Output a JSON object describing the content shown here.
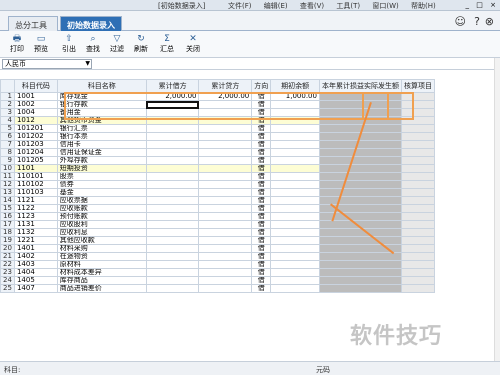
{
  "window": {
    "title": "[初始数据录入]",
    "menus": [
      "文件(F)",
      "编辑(E)",
      "查看(V)",
      "工具(T)",
      "窗口(W)",
      "帮助(H)"
    ],
    "controls": [
      "_",
      "□",
      "×"
    ]
  },
  "tabs": [
    {
      "label": "总分工具",
      "active": false
    },
    {
      "label": "初始数据录入",
      "active": true,
      "close": "×"
    }
  ],
  "toolbar": [
    {
      "label": "打印",
      "icon": "printer-icon",
      "glyph": "🖶"
    },
    {
      "label": "预览",
      "icon": "preview-icon",
      "glyph": "▭"
    },
    {
      "label": "引出",
      "icon": "export-icon",
      "glyph": "⇧"
    },
    {
      "label": "查找",
      "icon": "find-icon",
      "glyph": "⌕"
    },
    {
      "label": "过滤",
      "icon": "filter-icon",
      "glyph": "▽"
    },
    {
      "label": "刷新",
      "icon": "refresh-icon",
      "glyph": "↻"
    },
    {
      "label": "汇总",
      "icon": "summary-icon",
      "glyph": "Σ"
    },
    {
      "label": "关闭",
      "icon": "close-icon",
      "glyph": "✕"
    }
  ],
  "filter": {
    "currency": "人民币"
  },
  "headers": {
    "code": "科目代码",
    "name": "科目名称",
    "debit": "累计借方",
    "credit": "累计贷方",
    "dir": "方向",
    "balance": "期初余额",
    "year_profit": "本年累计损益实际发生额",
    "check": "核算项目"
  },
  "rows": [
    {
      "n": "1",
      "code": "1001",
      "name": "库存现金",
      "debit": "2,000.00",
      "credit": "2,000.00",
      "dir": "借",
      "bal": "1,000.00"
    },
    {
      "n": "2",
      "code": "1002",
      "name": "银行存款",
      "debit": "",
      "credit": "",
      "dir": "借",
      "bal": ""
    },
    {
      "n": "3",
      "code": "1004",
      "name": "  备用金",
      "debit": "",
      "credit": "",
      "dir": "借",
      "bal": ""
    },
    {
      "n": "4",
      "code": "1012",
      "name": "其他货币资金",
      "debit": "",
      "credit": "",
      "dir": "借",
      "bal": ""
    },
    {
      "n": "5",
      "code": "101201",
      "name": "  银行汇票",
      "debit": "",
      "credit": "",
      "dir": "借",
      "bal": ""
    },
    {
      "n": "6",
      "code": "101202",
      "name": "  银行本票",
      "debit": "",
      "credit": "",
      "dir": "借",
      "bal": ""
    },
    {
      "n": "7",
      "code": "101203",
      "name": "  信用卡",
      "debit": "",
      "credit": "",
      "dir": "借",
      "bal": ""
    },
    {
      "n": "8",
      "code": "101204",
      "name": "  信用证保证金",
      "debit": "",
      "credit": "",
      "dir": "借",
      "bal": ""
    },
    {
      "n": "9",
      "code": "101205",
      "name": "  外埠存款",
      "debit": "",
      "credit": "",
      "dir": "借",
      "bal": ""
    },
    {
      "n": "10",
      "code": "1101",
      "name": "短期投资",
      "debit": "",
      "credit": "",
      "dir": "借",
      "bal": ""
    },
    {
      "n": "11",
      "code": "110101",
      "name": "  股票",
      "debit": "",
      "credit": "",
      "dir": "借",
      "bal": ""
    },
    {
      "n": "12",
      "code": "110102",
      "name": "  债券",
      "debit": "",
      "credit": "",
      "dir": "借",
      "bal": ""
    },
    {
      "n": "13",
      "code": "110103",
      "name": "  基金",
      "debit": "",
      "credit": "",
      "dir": "借",
      "bal": ""
    },
    {
      "n": "14",
      "code": "1121",
      "name": "应收票据",
      "debit": "",
      "credit": "",
      "dir": "借",
      "bal": ""
    },
    {
      "n": "15",
      "code": "1122",
      "name": "应收账款",
      "debit": "",
      "credit": "",
      "dir": "借",
      "bal": ""
    },
    {
      "n": "16",
      "code": "1123",
      "name": "预付账款",
      "debit": "",
      "credit": "",
      "dir": "借",
      "bal": ""
    },
    {
      "n": "17",
      "code": "1131",
      "name": "应收股利",
      "debit": "",
      "credit": "",
      "dir": "借",
      "bal": ""
    },
    {
      "n": "18",
      "code": "1132",
      "name": "应收利息",
      "debit": "",
      "credit": "",
      "dir": "借",
      "bal": ""
    },
    {
      "n": "19",
      "code": "1221",
      "name": "其他应收款",
      "debit": "",
      "credit": "",
      "dir": "借",
      "bal": ""
    },
    {
      "n": "20",
      "code": "1401",
      "name": "材料采购",
      "debit": "",
      "credit": "",
      "dir": "借",
      "bal": ""
    },
    {
      "n": "21",
      "code": "1402",
      "name": "在途物资",
      "debit": "",
      "credit": "",
      "dir": "借",
      "bal": ""
    },
    {
      "n": "22",
      "code": "1403",
      "name": "原材料",
      "debit": "",
      "credit": "",
      "dir": "借",
      "bal": ""
    },
    {
      "n": "23",
      "code": "1404",
      "name": "材料成本差异",
      "debit": "",
      "credit": "",
      "dir": "借",
      "bal": ""
    },
    {
      "n": "24",
      "code": "1405",
      "name": "库存商品",
      "debit": "",
      "credit": "",
      "dir": "借",
      "bal": ""
    },
    {
      "n": "25",
      "code": "1407",
      "name": "商品进销差价",
      "debit": "",
      "credit": "",
      "dir": "借",
      "bal": ""
    }
  ],
  "status": {
    "left": "科目:",
    "right": "元码"
  },
  "watermark": "软件技巧",
  "colors": {
    "accent": "#2e6fb5",
    "highlight_orange": "#f0a050",
    "yellow_row": "#fdfdd4",
    "gray_col": "#bcbcbc"
  }
}
